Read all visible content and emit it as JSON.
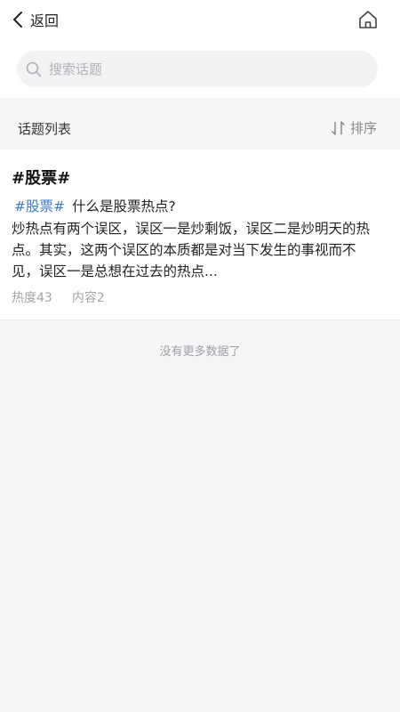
{
  "header": {
    "back_label": "返回",
    "back_icon": "chevron-left-icon",
    "home_icon": "home-icon"
  },
  "search": {
    "placeholder": "搜索话题",
    "value": "",
    "icon": "search-icon"
  },
  "list": {
    "title": "话题列表",
    "sort_label": "排序",
    "sort_icon": "sort-icon"
  },
  "topic": {
    "name": "#股票#",
    "post": {
      "tag": "#股票#",
      "title": "什么是股票热点?",
      "body": "炒热点有两个误区，误区一是炒剩饭，误区二是炒明天的热点。其实，这两个误区的本质都是对当下发生的事视而不见，误区一是总想在过去的热点..."
    },
    "heat_label": "热度43",
    "content_label": "内容2"
  },
  "footer": {
    "no_more": "没有更多数据了"
  },
  "colors": {
    "accent": "#3f78c4",
    "page_background": "#f6f6f8",
    "muted_text": "#a6a6aa"
  }
}
